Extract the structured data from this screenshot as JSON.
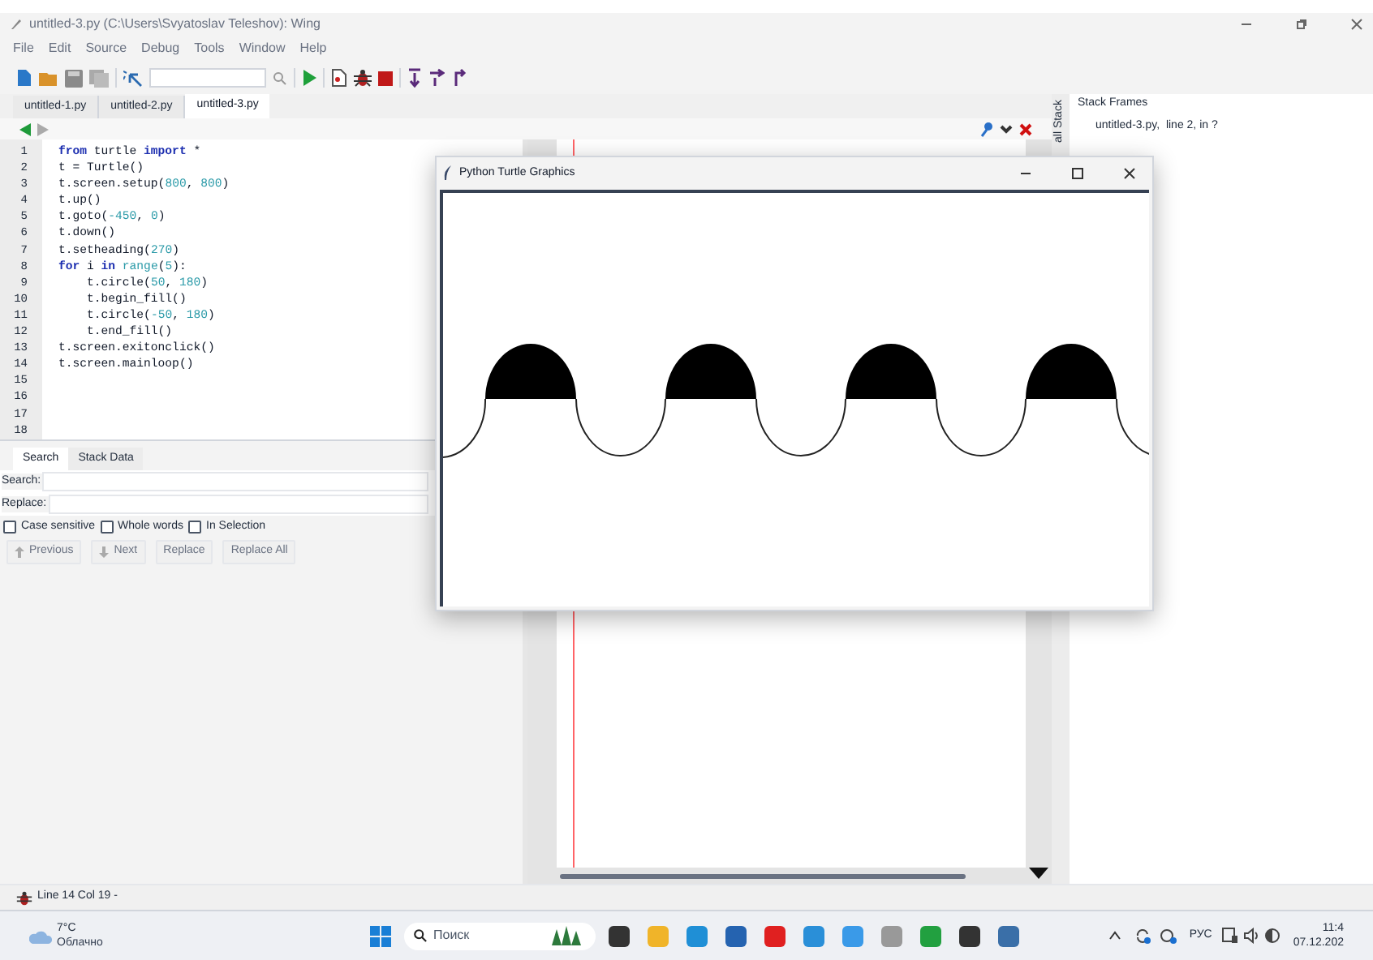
{
  "window": {
    "title": "untitled-3.py (C:\\Users\\Svyatoslav Teleshov): Wing"
  },
  "menu": [
    "File",
    "Edit",
    "Source",
    "Debug",
    "Tools",
    "Window",
    "Help"
  ],
  "tabs": [
    {
      "label": "untitled-1.py",
      "selected": false
    },
    {
      "label": "untitled-2.py",
      "selected": false
    },
    {
      "label": "untitled-3.py",
      "selected": true
    }
  ],
  "code": [
    {
      "number": "1",
      "tokens": [
        {
          "t": "from",
          "kind": "kw"
        },
        {
          "t": " turtle ",
          "kind": "id"
        },
        {
          "t": "import",
          "kind": "kw"
        },
        {
          "t": " *",
          "kind": "id"
        }
      ]
    },
    {
      "number": "2",
      "tokens": [
        {
          "t": "t = Turtle()",
          "kind": "id"
        }
      ]
    },
    {
      "number": "3",
      "tokens": [
        {
          "t": "t.screen.setup(",
          "kind": "id"
        },
        {
          "t": "800",
          "kind": "num"
        },
        {
          "t": ", ",
          "kind": "id"
        },
        {
          "t": "800",
          "kind": "num"
        },
        {
          "t": ")",
          "kind": "id"
        }
      ]
    },
    {
      "number": "4",
      "tokens": [
        {
          "t": "t.up()",
          "kind": "id"
        }
      ]
    },
    {
      "number": "5",
      "tokens": [
        {
          "t": "t.goto(",
          "kind": "id"
        },
        {
          "t": "-450",
          "kind": "num"
        },
        {
          "t": ", ",
          "kind": "id"
        },
        {
          "t": "0",
          "kind": "num"
        },
        {
          "t": ")",
          "kind": "id"
        }
      ]
    },
    {
      "number": "6",
      "tokens": [
        {
          "t": "t.down()",
          "kind": "id"
        }
      ]
    },
    {
      "number": "7",
      "tokens": [
        {
          "t": "t.setheading(",
          "kind": "id"
        },
        {
          "t": "270",
          "kind": "num"
        },
        {
          "t": ")",
          "kind": "id"
        }
      ]
    },
    {
      "number": "8",
      "tokens": [
        {
          "t": "for",
          "kind": "kw"
        },
        {
          "t": " i ",
          "kind": "id"
        },
        {
          "t": "in",
          "kind": "kw"
        },
        {
          "t": " range",
          "kind": "num"
        },
        {
          "t": "(",
          "kind": "id"
        },
        {
          "t": "5",
          "kind": "num"
        },
        {
          "t": "):",
          "kind": "id"
        }
      ]
    },
    {
      "number": "9",
      "tokens": [
        {
          "t": "    t.circle(",
          "kind": "id"
        },
        {
          "t": "50",
          "kind": "num"
        },
        {
          "t": ", ",
          "kind": "id"
        },
        {
          "t": "180",
          "kind": "num"
        },
        {
          "t": ")",
          "kind": "id"
        }
      ]
    },
    {
      "number": "10",
      "tokens": [
        {
          "t": "    t.begin_fill()",
          "kind": "id"
        }
      ]
    },
    {
      "number": "11",
      "tokens": [
        {
          "t": "    t.circle(",
          "kind": "id"
        },
        {
          "t": "-50",
          "kind": "num"
        },
        {
          "t": ", ",
          "kind": "id"
        },
        {
          "t": "180",
          "kind": "num"
        },
        {
          "t": ")",
          "kind": "id"
        }
      ]
    },
    {
      "number": "12",
      "tokens": [
        {
          "t": "    t.end_fill()",
          "kind": "id"
        }
      ]
    },
    {
      "number": "13",
      "tokens": [
        {
          "t": "t.screen.exitonclick()",
          "kind": "id"
        }
      ]
    },
    {
      "number": "14",
      "tokens": [
        {
          "t": "t.screen.mainloop()",
          "kind": "id"
        }
      ]
    },
    {
      "number": "15"
    },
    {
      "number": "16"
    },
    {
      "number": "17"
    },
    {
      "number": "18"
    }
  ],
  "bottom_tabs": [
    {
      "label": "Search",
      "selected": true
    },
    {
      "label": "Stack Data",
      "selected": false
    }
  ],
  "search": {
    "search_label": "Search:",
    "replace_label": "Replace:"
  },
  "options": [
    {
      "label": "Case sensitive",
      "checked": false
    },
    {
      "label": "Whole words",
      "checked": false
    },
    {
      "label": "In Selection",
      "checked": false
    }
  ],
  "buttons": [
    {
      "label": "Previous",
      "kind": "up"
    },
    {
      "label": "Next",
      "kind": "down"
    },
    {
      "label": "Replace",
      "kind": "plain"
    },
    {
      "label": "Replace All",
      "kind": "plain"
    }
  ],
  "stack_panel": {
    "tab": "all Stack",
    "title": "Stack Frames",
    "frames": [
      "untitled-3.py,  line 2, in ?"
    ]
  },
  "turtle_window": {
    "title": "Python Turtle Graphics"
  },
  "status_bar": {
    "text": "Line 14 Col 19 -"
  },
  "taskbar": {
    "temperature": "7°C",
    "weather": "Облачно",
    "search_placeholder": "Поиск",
    "language": "РУС",
    "time": "11:4",
    "date": "07.12.202"
  }
}
